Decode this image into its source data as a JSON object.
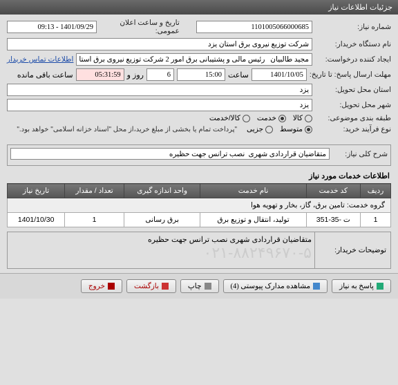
{
  "titlebar": "جزئیات اطلاعات نیاز",
  "fields": {
    "need_no_label": "شماره نیاز:",
    "need_no": "1101005066000685",
    "announce_label": "تاریخ و ساعت اعلان عمومی:",
    "announce": "1401/09/29 - 09:13",
    "buyer_label": "نام دستگاه خریدار:",
    "buyer": "شرکت توزیع نیروی برق استان یزد",
    "creator_label": "ایجاد کننده درخواست:",
    "creator": "مجید طالبیان   رئیس مالی و پشتیبانی برق امور 2 شرکت توزیع نیروی برق استان",
    "contact_link": "اطلاعات تماس خریدار",
    "deadline_label": "مهلت ارسال پاسخ: تا تاریخ:",
    "deadline_date": "1401/10/05",
    "time_label": "ساعت",
    "deadline_time": "15:00",
    "day_label": "روز و",
    "days": "6",
    "remain_time": "05:31:59",
    "remain_label": "ساعت باقی مانده",
    "province_label": "استان محل تحویل:",
    "province": "یزد",
    "city_label": "شهر محل تحویل:",
    "city": "یزد",
    "subject_type_label": "طبقه بندی موضوعی:",
    "r_kala": "کالا",
    "r_khadmat": "خدمت",
    "r_kala_khadmat": "کالا/خدمت",
    "process_label": "نوع فرآیند خرید:",
    "r_motevaset": "متوسط",
    "r_jozi": "جزیی",
    "process_note": "\"پرداخت تمام یا بخشی از مبلغ خرید،از محل \"اسناد خزانه اسلامی\" خواهد بود.\"",
    "desc_title_label": "شرح کلی نیاز:",
    "desc_title": "متقاضیان قراردادی شهری  نصب ترانس جهت حظیره",
    "services_title": "اطلاعات خدمات مورد نیاز",
    "group_label": "گروه خدمت:",
    "group": "تامین برق، گاز، بخار و تهویه هوا",
    "buyer_notes_label": "توضیحات خریدار:",
    "buyer_notes": "متقاضیان قراردادی شهری  نصب ترانس جهت حظیره",
    "watermark": "۰۲۱-۸۸۲۴۹۶۷۰-۵"
  },
  "table": {
    "headers": {
      "row": "ردیف",
      "code": "کد خدمت",
      "name": "نام خدمت",
      "unit": "واحد اندازه گیری",
      "qty": "تعداد / مقدار",
      "date": "تاریخ نیاز"
    },
    "rows": [
      {
        "row": "1",
        "code": "ت -35-351",
        "name": "تولید، انتقال و توزیع برق",
        "unit": "برق رسانی",
        "qty": "1",
        "date": "1401/10/30"
      }
    ]
  },
  "buttons": {
    "reply": "پاسخ به نیاز",
    "attachments": "مشاهده مدارک پیوستی (4)",
    "print": "چاپ",
    "back": "بازگشت",
    "exit": "خروج"
  }
}
